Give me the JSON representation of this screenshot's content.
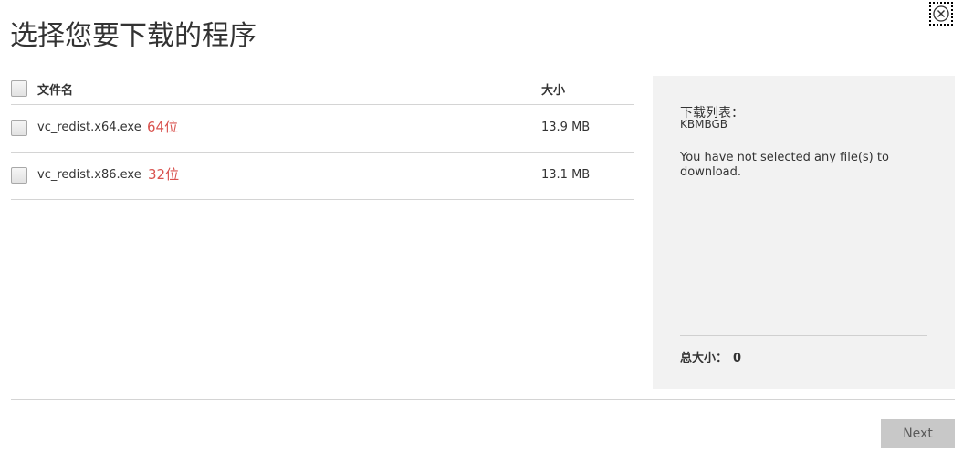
{
  "dialog": {
    "title": "选择您要下载的程序",
    "close_icon": "close-circle-icon"
  },
  "table": {
    "headers": {
      "name": "文件名",
      "size": "大小"
    },
    "files": [
      {
        "name": "vc_redist.x64.exe",
        "tag": "64位",
        "size": "13.9 MB",
        "checked": false
      },
      {
        "name": "vc_redist.x86.exe",
        "tag": "32位",
        "size": "13.1 MB",
        "checked": false
      }
    ]
  },
  "summary": {
    "heading": "下载列表：",
    "sub": "KBMBGB",
    "message": "You have not selected any file(s) to download.",
    "total_label": "总大小：",
    "total_value": "0"
  },
  "footer": {
    "next_label": "Next"
  },
  "colors": {
    "tag_red": "#d9534f",
    "panel_bg": "#f2f2f2",
    "button_bg": "#c8c8c8"
  }
}
